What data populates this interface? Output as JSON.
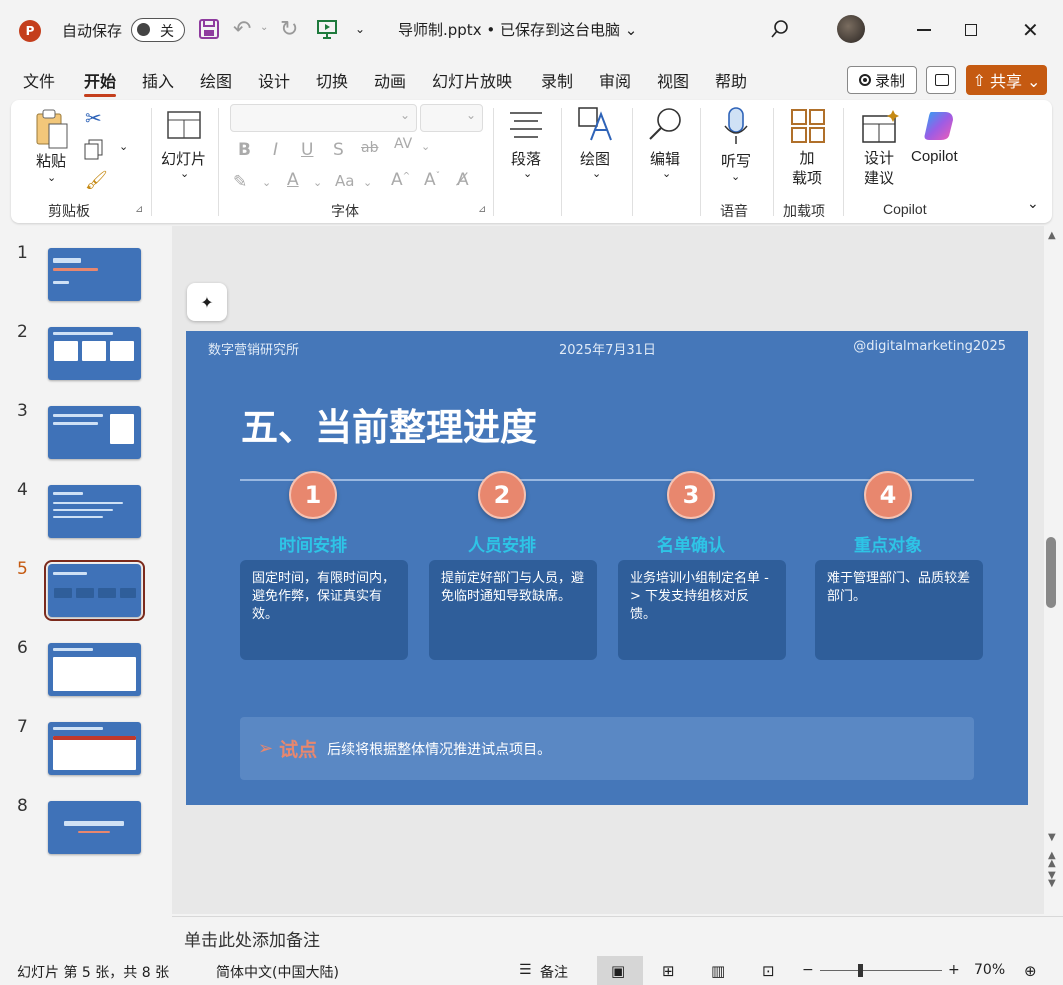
{
  "titlebar": {
    "autosave_label": "自动保存",
    "autosave_state": "关",
    "doc_title": "导师制.pptx • 已保存到这台电脑 ⌄",
    "app_logo": "P",
    "close": "✕"
  },
  "menu": {
    "tabs": [
      "文件",
      "开始",
      "插入",
      "绘图",
      "设计",
      "切换",
      "动画",
      "幻灯片放映",
      "录制",
      "审阅",
      "视图",
      "帮助"
    ],
    "active_tab": "开始",
    "record_label": "录制",
    "share_label": "共享 ⌄"
  },
  "ribbon": {
    "paste_label": "粘贴",
    "clipboard_group": "剪贴板",
    "slides_label": "幻灯片",
    "font_group": "字体",
    "paragraph_label": "段落",
    "draw_label": "绘图",
    "edit_label": "编辑",
    "dictate_label": "听写",
    "voice_group": "语音",
    "addins_label": "加\n载项",
    "addins_group": "加载项",
    "designer_label": "设计\n建议",
    "copilot_label": "Copilot",
    "copilot_group": "Copilot"
  },
  "thumbnails": [
    "1",
    "2",
    "3",
    "4",
    "5",
    "6",
    "7",
    "8"
  ],
  "active_slide": 5,
  "slide": {
    "org": "数字营销研究所",
    "date": "2025年7月31日",
    "handle": "@digitalmarketing2025",
    "title": "五、当前整理进度",
    "steps": [
      {
        "num": "1",
        "title": "时间安排",
        "text": "固定时间，有限时间内，避免作弊，保证真实有效。"
      },
      {
        "num": "2",
        "title": "人员安排",
        "text": "提前定好部门与人员，避免临时通知导致缺席。"
      },
      {
        "num": "3",
        "title": "名单确认",
        "text": "业务培训小组制定名单 -> 下发支持组核对反馈。"
      },
      {
        "num": "4",
        "title": "重点对象",
        "text": "难于管理部门、品质较差部门。"
      }
    ],
    "pilot_arrow": "➢",
    "pilot_label": "试点",
    "pilot_text": "后续将根据整体情况推进试点项目。"
  },
  "notes": {
    "placeholder": "单击此处添加备注"
  },
  "status": {
    "slide_info": "幻灯片 第 5 张，共 8 张",
    "language": "简体中文(中国大陆)",
    "notes_label": "备注",
    "zoom": "70%"
  },
  "colors": {
    "accent": "#c43e1c",
    "share": "#c55a11",
    "slide_bg": "#4577b9",
    "step_circle": "#e8876e",
    "step_title": "#2ec4e6"
  }
}
